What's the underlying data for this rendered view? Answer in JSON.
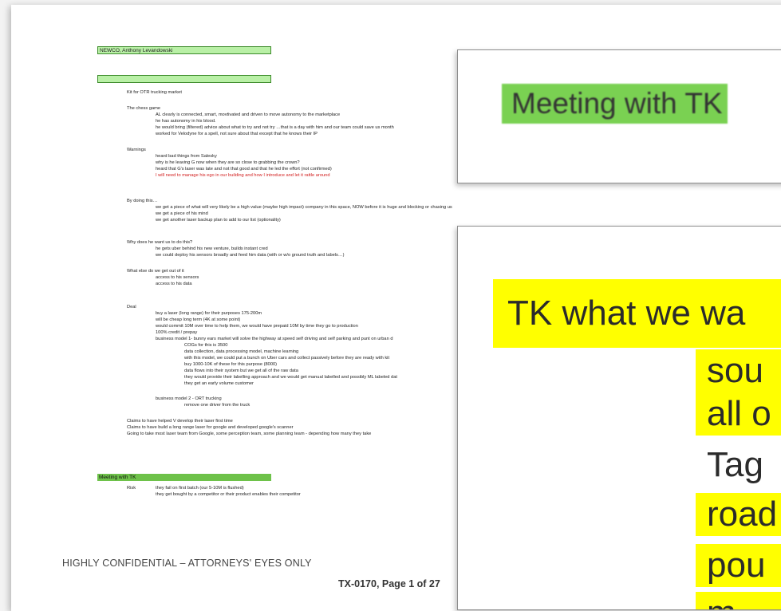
{
  "document": {
    "title_highlight": "NEWCO, Anthony Levandowski",
    "lines": [
      {
        "text": "Kit for OTR trucking market",
        "indent": 1
      },
      {
        "text": "The chess game",
        "indent": 1
      },
      {
        "text": "AL clearly is connected, smart, movtivated and driven to move autonomy to the marketplace",
        "indent": 2
      },
      {
        "text": "he has autonomy in his blood.",
        "indent": 2
      },
      {
        "text": "he would bring (filtered) advice about what to try and not try …that is a day with him and our team could save us month",
        "indent": 2
      },
      {
        "text": "worked for Velodyne for a spell, not sure about that except that he knows their IP",
        "indent": 2
      },
      {
        "text": "Warnings",
        "indent": 1
      },
      {
        "text": "heard bad things from Salesky",
        "indent": 2
      },
      {
        "text": "why is he leaving G now when they are so close to grabbing the crown?",
        "indent": 2
      },
      {
        "text": "heard that G's laser was late and not that good and that he led the effort (not confirmed)",
        "indent": 2
      },
      {
        "text": "I will need to manage his ego in our building and how I introduce and let it rattle around",
        "indent": 2,
        "red": true
      },
      {
        "text": "By doing this…",
        "indent": 1
      },
      {
        "text": "we get a piece of what will very likely be a high value (maybe high impact) company in this space, NOW before it is huge and blocking or chasing us",
        "indent": 2
      },
      {
        "text": "we get a piece of his mind",
        "indent": 2
      },
      {
        "text": "we get another laser backup plan to add to our list (optionality)",
        "indent": 2
      },
      {
        "text": "Why does he want us to do this?",
        "indent": 1
      },
      {
        "text": "he gets uber behind his new venture, builds instant cred",
        "indent": 2
      },
      {
        "text": "we could deploy his sensors broadly and feed him data (with or w/o ground truth and labels…)",
        "indent": 2
      },
      {
        "text": "What else do we get out of it",
        "indent": 1
      },
      {
        "text": "access to his sensors",
        "indent": 2
      },
      {
        "text": "access to his data",
        "indent": 2
      },
      {
        "text": "Deal",
        "indent": 1
      },
      {
        "text": "buy a laser (long range) for their purposes 175-200m",
        "indent": 2
      },
      {
        "text": "will be cheap long term (4K at some point)",
        "indent": 2
      },
      {
        "text": "would commit 10M over time to help them, we would have prepaid 10M by time they go to production",
        "indent": 2
      },
      {
        "text": "100% credit / prepay",
        "indent": 2
      },
      {
        "text": "business model 1- bunny ears market will solve the highway at speed self driving and self parking and punt on urban d",
        "indent": 2
      },
      {
        "text": "COGs for this is 3500",
        "indent": 3
      },
      {
        "text": "data collection, data processing model, machine learning",
        "indent": 3
      },
      {
        "text": "with this model, we could put a bunch on Uber cars and collect passively before they are ready with kit",
        "indent": 3
      },
      {
        "text": "buy 1000-10K of these for this purpose (8000)",
        "indent": 3
      },
      {
        "text": "data flows into their system but we get all of the raw data",
        "indent": 3
      },
      {
        "text": "they would provide their labelling approach and we would get manual labelled and possibly ML labeled dat",
        "indent": 3
      },
      {
        "text": "they get an early volume customer",
        "indent": 3
      },
      {
        "text": "business model 2 - ORT trucking",
        "indent": 2
      },
      {
        "text": "remove one driver from the truck",
        "indent": 3
      },
      {
        "text": "Claims to have helped V develop their laser first time",
        "indent": 1
      },
      {
        "text": "Claims to have build a long range laser for google and developed google's scanner",
        "indent": 1
      },
      {
        "text": "Going to take most laser team from Google, some perception team, some planning team - depending how many they take",
        "indent": 1
      },
      {
        "text": "they fail on first batch (our 5-10M is flushed)",
        "indent": 2
      },
      {
        "text": "they get bought by a competitor or their product enables their competitor",
        "indent": 2
      }
    ],
    "meeting_highlight": "Meeting with TK",
    "risk_label": "Risk",
    "confidential": "HIGHLY CONFIDENTIAL – ATTORNEYS' EYES ONLY",
    "page_number": "TX-0170, Page 1 of 27"
  },
  "zoom_top": {
    "text": "Meeting with TK"
  },
  "zoom_bottom": {
    "headline": "TK what we wa",
    "lines": [
      {
        "text": "sou",
        "highlight": true
      },
      {
        "text": "all o",
        "highlight": true
      },
      {
        "text": "Tag",
        "highlight": false
      },
      {
        "text": "road",
        "highlight": true
      },
      {
        "text": "pou",
        "highlight": true
      },
      {
        "text": "m",
        "highlight": true
      }
    ]
  },
  "colors": {
    "green_highlight": "#b9f0a6",
    "green_dark": "#6ec24a",
    "yellow_highlight": "#ffff00",
    "red_text": "#d21c1c"
  }
}
